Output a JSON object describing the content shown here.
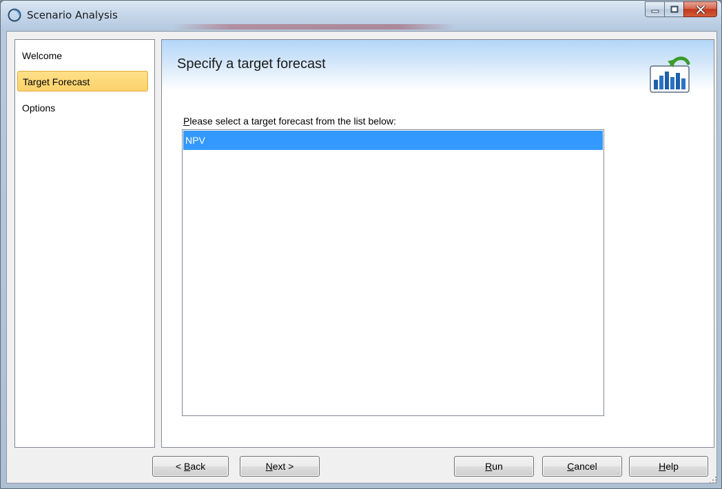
{
  "window": {
    "title": "Scenario Analysis"
  },
  "nav": {
    "items": [
      {
        "label": "Welcome",
        "selected": false
      },
      {
        "label": "Target Forecast",
        "selected": true
      },
      {
        "label": "Options",
        "selected": false
      }
    ]
  },
  "header": {
    "title": "Specify a target forecast",
    "icon": "chart-refresh-icon"
  },
  "main": {
    "prompt_accel": "P",
    "prompt_rest": "lease select a target forecast from the list below:",
    "list": {
      "items": [
        "NPV"
      ],
      "selected_index": 0
    }
  },
  "buttons": {
    "back": {
      "prefix": "< ",
      "accel": "B",
      "rest": "ack"
    },
    "next": {
      "prefix": "",
      "accel": "N",
      "rest": "ext >"
    },
    "run": {
      "accel": "R",
      "rest": "un"
    },
    "cancel": {
      "accel": "C",
      "rest": "ancel"
    },
    "help": {
      "accel": "H",
      "rest": "elp"
    }
  },
  "colors": {
    "selection_blue": "#3399ff",
    "nav_highlight": "#fcd26a",
    "close_red": "#c2391d"
  }
}
